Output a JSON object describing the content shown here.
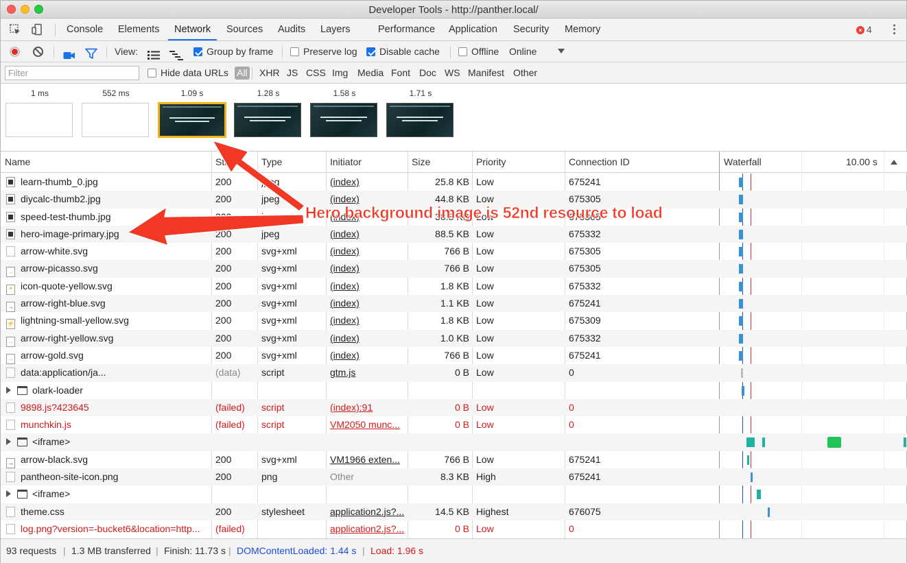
{
  "window": {
    "title": "Developer Tools - http://panther.local/"
  },
  "tabs": [
    {
      "label": "Console"
    },
    {
      "label": "Elements"
    },
    {
      "label": "Network"
    },
    {
      "label": "Sources"
    },
    {
      "label": "Audits"
    },
    {
      "label": "Layers"
    },
    {
      "label": "Performance"
    },
    {
      "label": "Application"
    },
    {
      "label": "Security"
    },
    {
      "label": "Memory"
    }
  ],
  "active_tab": "Network",
  "error_count": "4",
  "toolbar": {
    "view_label": "View:",
    "group_by_frame": {
      "label": "Group by frame",
      "checked": true
    },
    "preserve_log": {
      "label": "Preserve log",
      "checked": false
    },
    "disable_cache": {
      "label": "Disable cache",
      "checked": true
    },
    "offline": {
      "label": "Offline",
      "checked": false
    },
    "throttle": "Online"
  },
  "filterbar": {
    "placeholder": "Filter",
    "hide_data_urls": {
      "label": "Hide data URLs",
      "checked": false
    },
    "types": [
      "All",
      "XHR",
      "JS",
      "CSS",
      "Img",
      "Media",
      "Font",
      "Doc",
      "WS",
      "Manifest",
      "Other"
    ]
  },
  "filmstrip": [
    {
      "time": "1 ms",
      "thumb": "blank"
    },
    {
      "time": "552 ms",
      "thumb": "blank"
    },
    {
      "time": "1.09 s",
      "thumb": "hero",
      "selected": true
    },
    {
      "time": "1.28 s",
      "thumb": "hero"
    },
    {
      "time": "1.58 s",
      "thumb": "hero"
    },
    {
      "time": "1.71 s",
      "thumb": "hero"
    }
  ],
  "columns": {
    "name": "Name",
    "status": "Status",
    "type": "Type",
    "initiator": "Initiator",
    "size": "Size",
    "priority": "Priority",
    "connection": "Connection ID",
    "waterfall": "Waterfall",
    "waterfall_scale": "10.00 s"
  },
  "rows": [
    {
      "name": "learn-thumb_0.jpg",
      "icon": "img",
      "status": "200",
      "type": "jpeg",
      "initiator": "(index)",
      "size": "25.8 KB",
      "priority": "Low",
      "connection": "675241"
    },
    {
      "name": "diycalc-thumb2.jpg",
      "icon": "img",
      "status": "200",
      "type": "jpeg",
      "initiator": "(index)",
      "size": "44.8 KB",
      "priority": "Low",
      "connection": "675305"
    },
    {
      "name": "speed-test-thumb.jpg",
      "icon": "img",
      "status": "200",
      "type": "jpeg",
      "initiator": "(index)",
      "size": "38.8 KB",
      "priority": "Low",
      "connection": "675305"
    },
    {
      "name": "hero-image-primary.jpg",
      "icon": "img",
      "status": "200",
      "type": "jpeg",
      "initiator": "(index)",
      "size": "88.5 KB",
      "priority": "Low",
      "connection": "675332"
    },
    {
      "name": "arrow-white.svg",
      "icon": "plain-file",
      "status": "200",
      "type": "svg+xml",
      "initiator": "(index)",
      "size": "766 B",
      "priority": "Low",
      "connection": "675305"
    },
    {
      "name": "arrow-picasso.svg",
      "icon": "arrow",
      "status": "200",
      "type": "svg+xml",
      "initiator": "(index)",
      "size": "766 B",
      "priority": "Low",
      "connection": "675305"
    },
    {
      "name": "icon-quote-yellow.svg",
      "icon": "quote",
      "status": "200",
      "type": "svg+xml",
      "initiator": "(index)",
      "size": "1.8 KB",
      "priority": "Low",
      "connection": "675332"
    },
    {
      "name": "arrow-right-blue.svg",
      "icon": "arrow-blue",
      "status": "200",
      "type": "svg+xml",
      "initiator": "(index)",
      "size": "1.1 KB",
      "priority": "Low",
      "connection": "675241"
    },
    {
      "name": "lightning-small-yellow.svg",
      "icon": "bolt",
      "status": "200",
      "type": "svg+xml",
      "initiator": "(index)",
      "size": "1.8 KB",
      "priority": "Low",
      "connection": "675309"
    },
    {
      "name": "arrow-right-yellow.svg",
      "icon": "arrow",
      "status": "200",
      "type": "svg+xml",
      "initiator": "(index)",
      "size": "1.0 KB",
      "priority": "Low",
      "connection": "675332"
    },
    {
      "name": "arrow-gold.svg",
      "icon": "arrow",
      "status": "200",
      "type": "svg+xml",
      "initiator": "(index)",
      "size": "766 B",
      "priority": "Low",
      "connection": "675241"
    },
    {
      "name": "data:application/ja...",
      "icon": "plain-file",
      "status": "(data)",
      "type": "script",
      "initiator": "gtm.js",
      "size": "0 B",
      "priority": "Low",
      "connection": "0",
      "grey_status": true
    },
    {
      "name": "olark-loader",
      "group": true
    },
    {
      "name": "9898.js?423645",
      "icon": "plain-file",
      "status": "(failed)",
      "type": "script",
      "initiator": "(index):91",
      "size": "0 B",
      "priority": "Low",
      "connection": "0",
      "failed": true
    },
    {
      "name": "munchkin.js",
      "icon": "plain-file",
      "status": "(failed)",
      "type": "script",
      "initiator": "VM2050 munc...",
      "size": "0 B",
      "priority": "Low",
      "connection": "0",
      "failed": true
    },
    {
      "name": "<iframe>",
      "group": true
    },
    {
      "name": "arrow-black.svg",
      "icon": "arrow-dark",
      "status": "200",
      "type": "svg+xml",
      "initiator": "VM1966 exten...",
      "size": "766 B",
      "priority": "Low",
      "connection": "675241"
    },
    {
      "name": "pantheon-site-icon.png",
      "icon": "plain-file",
      "status": "200",
      "type": "png",
      "initiator": "Other",
      "size": "8.3 KB",
      "priority": "High",
      "connection": "675241",
      "plain_initiator": true
    },
    {
      "name": "<iframe>",
      "group": true
    },
    {
      "name": "theme.css",
      "icon": "plain-file",
      "status": "200",
      "type": "stylesheet",
      "initiator": "application2.js?...",
      "size": "14.5 KB",
      "priority": "Highest",
      "connection": "676075"
    },
    {
      "name": "log.png?version=-bucket6&location=http...",
      "icon": "plain-file",
      "status": "(failed)",
      "type": "",
      "initiator": "application2.js?...",
      "size": "0 B",
      "priority": "Low",
      "connection": "0",
      "failed": true
    }
  ],
  "statusbar": {
    "requests": "93 requests",
    "transferred": "1.3 MB transferred",
    "finish": "Finish: 11.73 s",
    "dcl": "DOMContentLoaded: 1.44 s",
    "load": "Load: 1.96 s"
  },
  "annotation": {
    "text": "Hero background image is 52nd resource to load",
    "color": "#f03824"
  },
  "colors": {
    "accent": "#1a73e8",
    "error": "#d01b1b",
    "dcl_line": "#1a50d6",
    "load_line": "#e0302a"
  }
}
